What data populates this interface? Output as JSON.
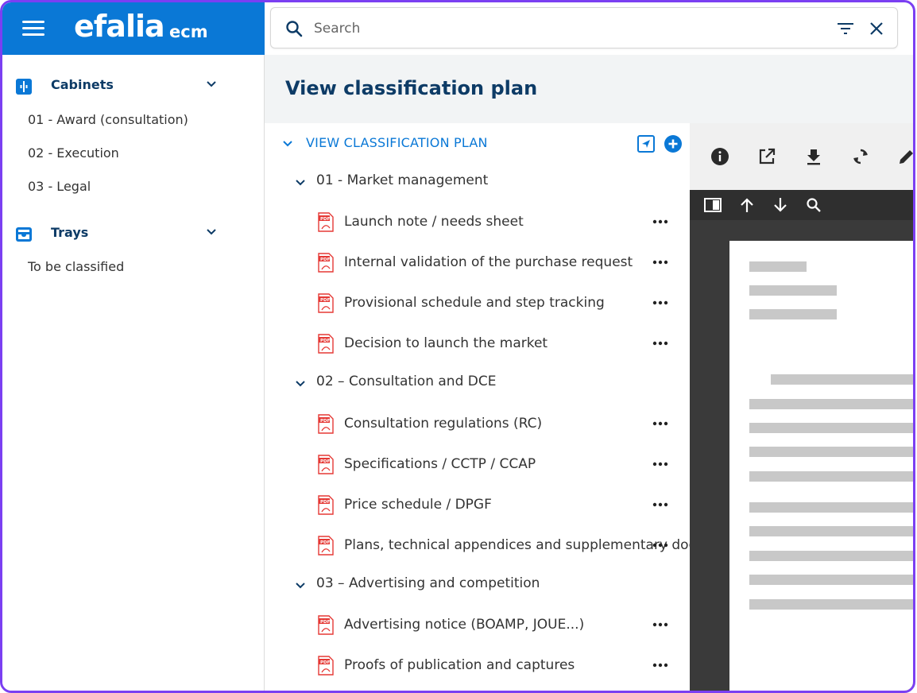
{
  "brand": {
    "logo": "efalia",
    "product": "ecm"
  },
  "sidebar": {
    "sections": [
      {
        "label": "Cabinets",
        "items": [
          "01 - Award (consultation)",
          "02 - Execution",
          "03 - Legal"
        ]
      },
      {
        "label": "Trays",
        "items": [
          "To be classified"
        ]
      }
    ]
  },
  "search": {
    "placeholder": "Search",
    "value": ""
  },
  "main": {
    "title": "View classification plan"
  },
  "tree": {
    "root_label": "VIEW CLASSIFICATION PLAN",
    "folders": [
      {
        "label": "01 - Market management",
        "docs": [
          "Launch note / needs sheet",
          "Internal validation of the purchase request",
          "Provisional schedule and step tracking",
          "Decision to launch the market"
        ]
      },
      {
        "label": "02 – Consultation and DCE",
        "docs": [
          "Consultation regulations (RC)",
          "Specifications / CCTP / CCAP",
          "Price schedule / DPGF",
          "Plans, technical appendices and supplementary documents"
        ]
      },
      {
        "label": "03 – Advertising and competition",
        "docs": [
          "Advertising notice (BOAMP, JOUE...)",
          "Proofs of publication and captures"
        ]
      }
    ]
  },
  "viewer": {
    "toolbar_icons": [
      "info-icon",
      "open-external-icon",
      "download-icon",
      "refresh-icon",
      "edit-icon"
    ],
    "bar_icons": [
      "sidebar-toggle-icon",
      "arrow-up-icon",
      "arrow-down-icon",
      "search-icon"
    ]
  },
  "colors": {
    "brand_blue": "#0a78d6",
    "navy": "#0d3b66",
    "frame_purple": "#7b3ff2",
    "pdf_red": "#e53935"
  }
}
